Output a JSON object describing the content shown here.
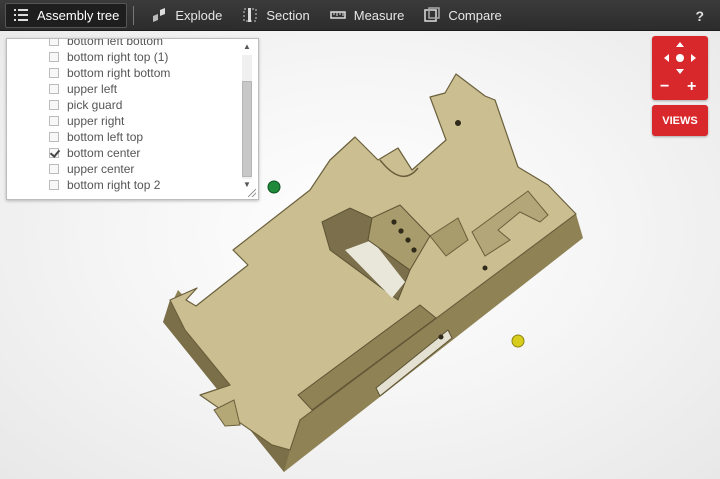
{
  "toolbar": {
    "assembly_tree": "Assembly tree",
    "explode": "Explode",
    "section": "Section",
    "measure": "Measure",
    "compare": "Compare",
    "help": "?"
  },
  "tree": {
    "items": [
      {
        "label": "bottom left bottom",
        "checked": false
      },
      {
        "label": "bottom right top (1)",
        "checked": false
      },
      {
        "label": "bottom right bottom",
        "checked": false
      },
      {
        "label": "upper left",
        "checked": false
      },
      {
        "label": "pick guard",
        "checked": false
      },
      {
        "label": "upper right",
        "checked": false
      },
      {
        "label": "bottom left top",
        "checked": false
      },
      {
        "label": "bottom center",
        "checked": true
      },
      {
        "label": "upper center",
        "checked": false
      },
      {
        "label": "bottom right top 2",
        "checked": false
      }
    ]
  },
  "nav": {
    "views_label": "VIEWS",
    "zoom_out": "−",
    "zoom_in": "+"
  },
  "colors": {
    "part_top": "#cbbf92",
    "part_side": "#9c8f62",
    "part_dark": "#6b603c",
    "accent_red": "#d9282c"
  },
  "icons": [
    "list-icon",
    "explode-icon",
    "section-icon",
    "measure-icon",
    "compare-icon",
    "pan-arrows-icon",
    "zoom-out-icon",
    "zoom-in-icon"
  ]
}
